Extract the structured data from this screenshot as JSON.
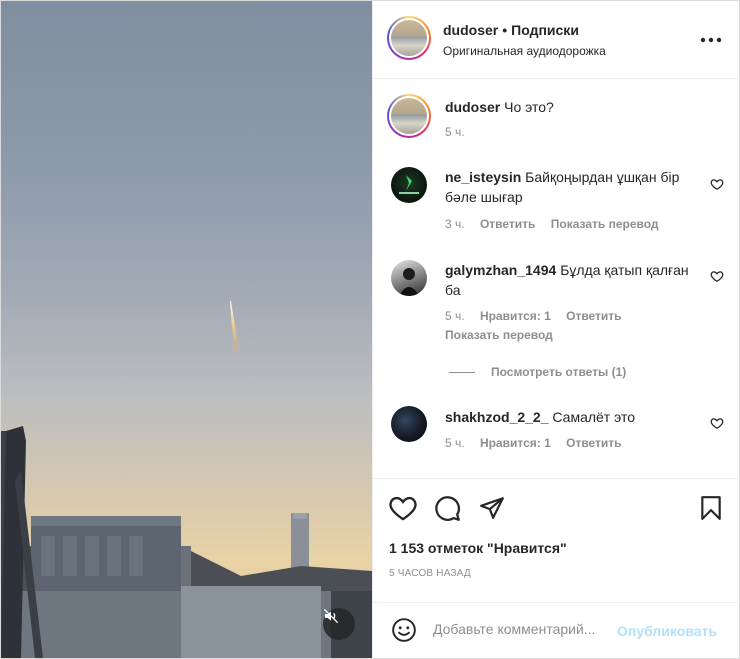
{
  "header": {
    "username": "dudoser",
    "separator": "•",
    "follow_label": "Подписки",
    "audio_label": "Оригинальная аудиодорожка",
    "more_icon": "more-horizontal-icon"
  },
  "caption": {
    "username": "dudoser",
    "text": "Чо это?",
    "time": "5 ч."
  },
  "comments": [
    {
      "username": "ne_isteysin",
      "text": "Байқоңырдан ұшқан бір бәле шығар",
      "time": "3 ч.",
      "reply_label": "Ответить",
      "translate_label": "Показать перевод"
    },
    {
      "username": "galymzhan_1494",
      "text": "Бұлда қатып қалған ба",
      "time": "5 ч.",
      "likes_label": "Нравится: 1",
      "reply_label": "Ответить",
      "translate_label": "Показать перевод",
      "view_replies_label": "Посмотреть ответы (1)"
    },
    {
      "username": "shakhzod_2_2_",
      "text": "Самалёт это",
      "time": "5 ч.",
      "likes_label": "Нравится: 1",
      "reply_label": "Ответить"
    }
  ],
  "actions": {
    "likes_count": "1 153 отметок \"Нравится\"",
    "posted_ago": "5 ЧАСОВ НАЗАД"
  },
  "add_comment": {
    "placeholder": "Добавьте комментарий...",
    "publish_label": "Опубликовать"
  },
  "colors": {
    "link_disabled": "#b2dffc",
    "secondary_text": "#8e8e8e",
    "primary_text": "#262626"
  }
}
